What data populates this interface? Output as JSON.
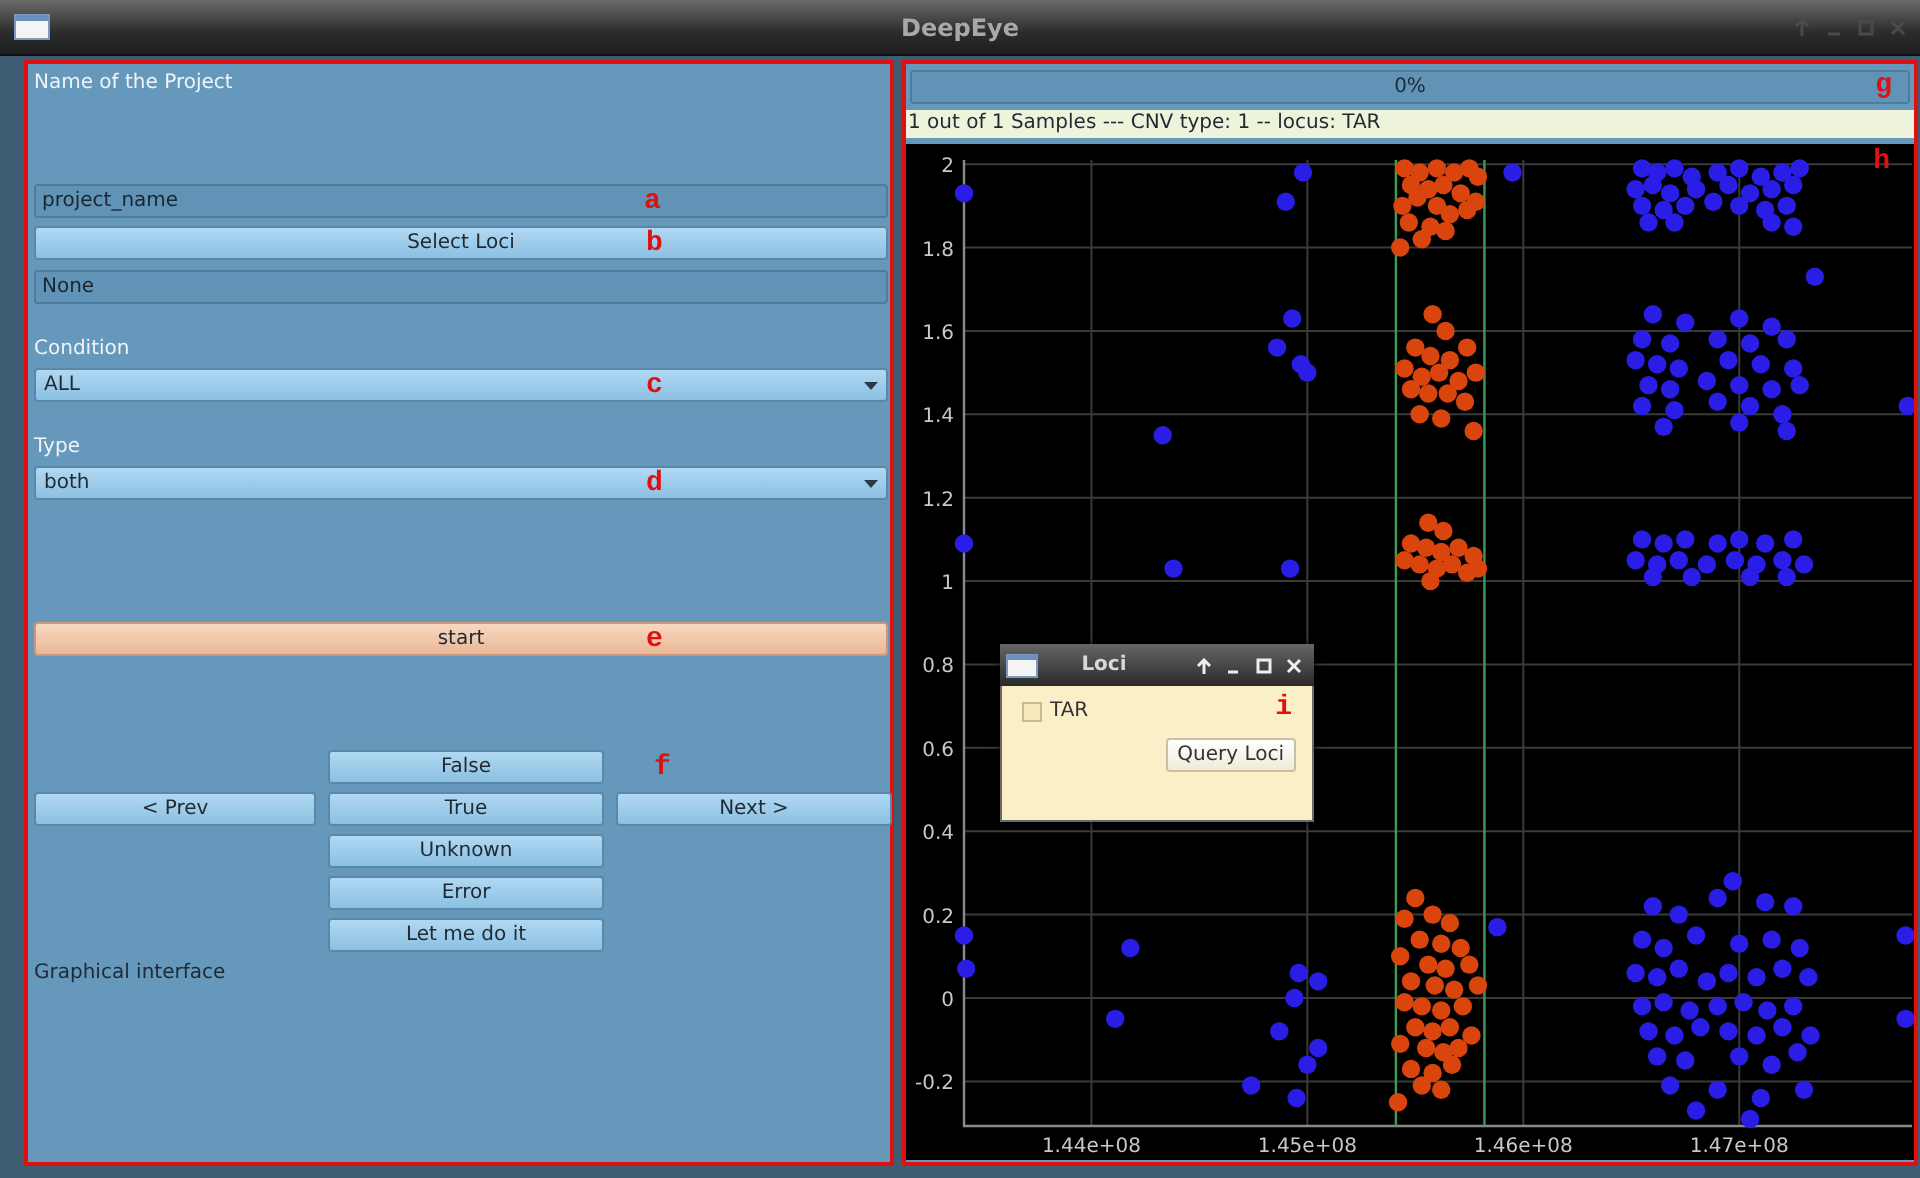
{
  "window": {
    "title": "DeepEye"
  },
  "controls": {
    "project_label": "Name of the Project",
    "project_field": {
      "value": "project_name",
      "tag": "a"
    },
    "select_loci_button": {
      "label": "Select Loci",
      "tag": "b"
    },
    "selected_loci": {
      "value": "None"
    },
    "condition": {
      "label": "Condition",
      "value": "ALL",
      "tag": "c"
    },
    "type": {
      "label": "Type",
      "value": "both",
      "tag": "d"
    },
    "start_button": {
      "label": "start",
      "tag": "e"
    },
    "labeling": {
      "tag": "f",
      "prev": "< Prev",
      "next": "Next >",
      "choices": [
        "False",
        "True",
        "Unknown",
        "Error",
        "Let me do it"
      ]
    },
    "footer": "Graphical interface"
  },
  "viewer": {
    "progress": {
      "text": "0%",
      "level": 0,
      "tag": "g"
    },
    "info": "1 out of 1 Samples --- CNV type: 1 -- locus: TAR",
    "plot": {
      "tag": "h",
      "chart_data": {
        "type": "scatter",
        "xlim": [
          143410000,
          147800000
        ],
        "ylim": [
          -0.307,
          2.01
        ],
        "xticks": [
          {
            "value": 144000000,
            "label": "1.44e+08"
          },
          {
            "value": 145000000,
            "label": "1.45e+08"
          },
          {
            "value": 146000000,
            "label": "1.46e+08"
          },
          {
            "value": 147000000,
            "label": "1.47e+08"
          }
        ],
        "yticks": [
          -0.2,
          0,
          0.2,
          0.4,
          0.6,
          0.8,
          1,
          1.2,
          1.4,
          1.6,
          1.8,
          2
        ],
        "grid": true,
        "ref_lines": [
          {
            "axis": "x",
            "value": 145410000,
            "color": "#3f9a55"
          },
          {
            "axis": "x",
            "value": 145820000,
            "color": "#3f9a55"
          }
        ],
        "series": [
          {
            "color": "#2a1ee6",
            "x": [
              146550000.0,
              146620000.0,
              146700000.0,
              146780000.0,
              146900000.0,
              147000000.0,
              147100000.0,
              147200000.0,
              147280000.0,
              146520000.0,
              146600000.0,
              146680000.0,
              146800000.0,
              146950000.0,
              147050000.0,
              147150000.0,
              147250000.0,
              146550000.0,
              146650000.0,
              146750000.0,
              146880000.0,
              147000000.0,
              147120000.0,
              147220000.0,
              146580000.0,
              146700000.0,
              147150000.0,
              147250000.0,
              146600000.0,
              146750000.0,
              147000000.0,
              147150000.0,
              146550000.0,
              146680000.0,
              146900000.0,
              147050000.0,
              147220000.0,
              146520000.0,
              146620000.0,
              146720000.0,
              146950000.0,
              147100000.0,
              147250000.0,
              146580000.0,
              146680000.0,
              146850000.0,
              147000000.0,
              147150000.0,
              147280000.0,
              146550000.0,
              146700000.0,
              146900000.0,
              147050000.0,
              147200000.0,
              146650000.0,
              147000000.0,
              147220000.0,
              147350000.0,
              147780000.0,
              146550000.0,
              146650000.0,
              146750000.0,
              146900000.0,
              147000000.0,
              147120000.0,
              147250000.0,
              146520000.0,
              146620000.0,
              146720000.0,
              146850000.0,
              146980000.0,
              147080000.0,
              147200000.0,
              147300000.0,
              146600000.0,
              146780000.0,
              147050000.0,
              147220000.0,
              146970000.0,
              146600000.0,
              146720000.0,
              146900000.0,
              147120000.0,
              147250000.0,
              146550000.0,
              146650000.0,
              146800000.0,
              147000000.0,
              147150000.0,
              147280000.0,
              146520000.0,
              146620000.0,
              146720000.0,
              146850000.0,
              146950000.0,
              147080000.0,
              147200000.0,
              147320000.0,
              146550000.0,
              146650000.0,
              146770000.0,
              146900000.0,
              147020000.0,
              147130000.0,
              147250000.0,
              146580000.0,
              146700000.0,
              146820000.0,
              146950000.0,
              147080000.0,
              147200000.0,
              147330000.0,
              146620000.0,
              146750000.0,
              147000000.0,
              147150000.0,
              147270000.0,
              146680000.0,
              146900000.0,
              147100000.0,
              147300000.0,
              146800000.0,
              147050000.0,
              147770000.0,
              147770000.0,
              143410000.0,
              144900000.0,
              144980000.0,
              145950000.0,
              144330000.0,
              144380000.0,
              144860000.0,
              144930000.0,
              144970000.0,
              145000000.0,
              144920000.0,
              143410000.0,
              143410000.0,
              143420000.0,
              144180000.0,
              144110000.0,
              144740000.0,
              144870000.0,
              144940000.0,
              144960000.0,
              145000000.0,
              145050000.0,
              145050000.0,
              144950000.0,
              145880000.0
            ],
            "values": [
              1.99,
              1.98,
              1.99,
              1.97,
              1.98,
              1.99,
              1.97,
              1.98,
              1.99,
              1.94,
              1.95,
              1.93,
              1.94,
              1.95,
              1.93,
              1.94,
              1.95,
              1.9,
              1.89,
              1.9,
              1.91,
              1.9,
              1.89,
              1.9,
              1.86,
              1.86,
              1.86,
              1.85,
              1.64,
              1.62,
              1.63,
              1.61,
              1.58,
              1.57,
              1.58,
              1.57,
              1.58,
              1.53,
              1.52,
              1.51,
              1.53,
              1.52,
              1.51,
              1.47,
              1.46,
              1.48,
              1.47,
              1.46,
              1.47,
              1.42,
              1.41,
              1.43,
              1.42,
              1.4,
              1.37,
              1.38,
              1.36,
              1.73,
              1.42,
              1.1,
              1.09,
              1.1,
              1.09,
              1.1,
              1.09,
              1.1,
              1.05,
              1.04,
              1.05,
              1.04,
              1.05,
              1.04,
              1.05,
              1.04,
              1.01,
              1.01,
              1.01,
              1.01,
              0.28,
              0.22,
              0.2,
              0.24,
              0.23,
              0.22,
              0.14,
              0.12,
              0.15,
              0.13,
              0.14,
              0.12,
              0.06,
              0.05,
              0.07,
              0.04,
              0.06,
              0.05,
              0.07,
              0.05,
              -0.02,
              -0.01,
              -0.03,
              -0.02,
              -0.01,
              -0.03,
              -0.02,
              -0.08,
              -0.09,
              -0.07,
              -0.08,
              -0.09,
              -0.07,
              -0.09,
              -0.14,
              -0.15,
              -0.14,
              -0.16,
              -0.13,
              -0.21,
              -0.22,
              -0.24,
              -0.22,
              -0.27,
              -0.29,
              0.15,
              -0.05,
              1.93,
              1.91,
              1.98,
              1.98,
              1.35,
              1.03,
              1.56,
              1.63,
              1.52,
              1.5,
              1.03,
              1.09,
              0.15,
              0.07,
              0.12,
              -0.05,
              -0.21,
              -0.08,
              0,
              0.06,
              -0.16,
              -0.12,
              0.04,
              -0.24,
              0.17
            ]
          },
          {
            "color": "#d9450c",
            "x": [
              145450000.0,
              145520000.0,
              145600000.0,
              145680000.0,
              145750000.0,
              145790000.0,
              145480000.0,
              145560000.0,
              145630000.0,
              145710000.0,
              145780000.0,
              145440000.0,
              145510000.0,
              145600000.0,
              145660000.0,
              145740000.0,
              145470000.0,
              145570000.0,
              145640000.0,
              145530000.0,
              145430000.0,
              145580000.0,
              145640000.0,
              145500000.0,
              145570000.0,
              145660000.0,
              145740000.0,
              145450000.0,
              145530000.0,
              145610000.0,
              145700000.0,
              145780000.0,
              145480000.0,
              145560000.0,
              145650000.0,
              145730000.0,
              145520000.0,
              145620000.0,
              145770000.0,
              145560000.0,
              145630000.0,
              145480000.0,
              145550000.0,
              145620000.0,
              145700000.0,
              145770000.0,
              145450000.0,
              145520000.0,
              145600000.0,
              145670000.0,
              145740000.0,
              145570000.0,
              145790000.0,
              145500000.0,
              145450000.0,
              145580000.0,
              145660000.0,
              145520000.0,
              145620000.0,
              145710000.0,
              145430000.0,
              145560000.0,
              145640000.0,
              145750000.0,
              145480000.0,
              145590000.0,
              145680000.0,
              145790000.0,
              145450000.0,
              145530000.0,
              145620000.0,
              145720000.0,
              145500000.0,
              145580000.0,
              145660000.0,
              145760000.0,
              145430000.0,
              145550000.0,
              145630000.0,
              145700000.0,
              145480000.0,
              145580000.0,
              145670000.0,
              145530000.0,
              145620000.0,
              145420000.0
            ],
            "values": [
              1.99,
              1.98,
              1.99,
              1.98,
              1.99,
              1.97,
              1.95,
              1.94,
              1.95,
              1.93,
              1.91,
              1.9,
              1.92,
              1.9,
              1.88,
              1.89,
              1.86,
              1.85,
              1.84,
              1.82,
              1.8,
              1.64,
              1.6,
              1.56,
              1.54,
              1.53,
              1.56,
              1.51,
              1.49,
              1.5,
              1.48,
              1.5,
              1.46,
              1.45,
              1.45,
              1.43,
              1.4,
              1.39,
              1.36,
              1.14,
              1.12,
              1.09,
              1.08,
              1.07,
              1.08,
              1.06,
              1.05,
              1.04,
              1.03,
              1.04,
              1.02,
              1.0,
              1.03,
              0.24,
              0.19,
              0.2,
              0.18,
              0.14,
              0.13,
              0.12,
              0.1,
              0.08,
              0.07,
              0.08,
              0.04,
              0.03,
              0.02,
              0.03,
              -0.01,
              -0.02,
              -0.03,
              -0.02,
              -0.07,
              -0.08,
              -0.07,
              -0.09,
              -0.11,
              -0.12,
              -0.13,
              -0.12,
              -0.17,
              -0.18,
              -0.16,
              -0.21,
              -0.22,
              -0.25
            ]
          }
        ]
      }
    },
    "dialog": {
      "title": "Loci",
      "tag": "i",
      "items": [
        {
          "label": "TAR",
          "checked": false
        }
      ],
      "button": "Query Loci"
    }
  }
}
